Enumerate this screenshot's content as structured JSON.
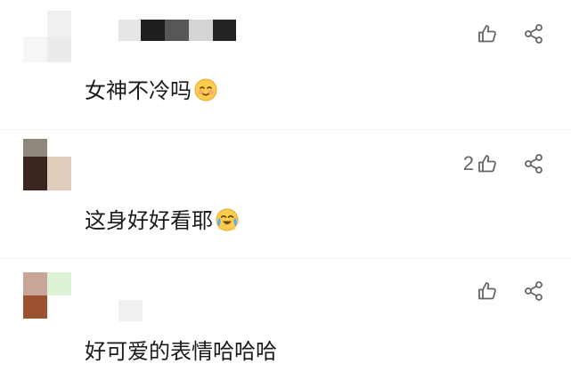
{
  "comments": [
    {
      "text": "女神不冷吗",
      "like_count": "",
      "emoji": "smiling-face-emoji"
    },
    {
      "text": "这身好好看耶",
      "like_count": "2",
      "emoji": "crying-laughing-face-emoji"
    },
    {
      "text": "好可爱的表情哈哈哈",
      "like_count": ""
    }
  ],
  "icons": {
    "like": "thumbs-up-icon",
    "share": "share-icon"
  },
  "colors": {
    "text": "#1a1a1a",
    "icon": "#666666",
    "like_count": "#666666",
    "background": "#ffffff"
  }
}
